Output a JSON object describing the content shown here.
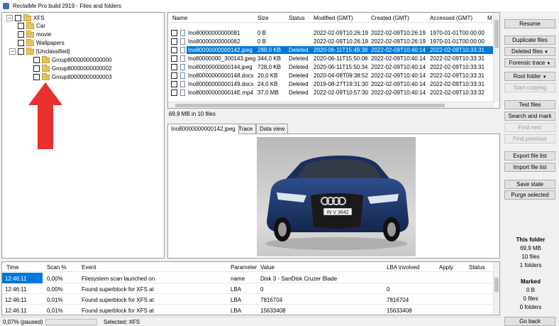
{
  "window": {
    "title": "ReclaiMe Pro build 2919 - Files and folders"
  },
  "tree": {
    "root": {
      "expander": "−",
      "label": "XFS"
    },
    "items": [
      {
        "expander": "",
        "label": "Car"
      },
      {
        "expander": "",
        "label": "movie"
      },
      {
        "expander": "",
        "label": "Wallpapers"
      },
      {
        "expander": "−",
        "label": "[Unclassified]"
      },
      {
        "expander": "",
        "label": "Group80000000000000"
      },
      {
        "expander": "",
        "label": "Group80000000000002"
      },
      {
        "expander": "",
        "label": "Group80000000000003"
      }
    ]
  },
  "filelist": {
    "columns": [
      "Name",
      "Size",
      "Status",
      "Modified (GMT)",
      "Created (GMT)",
      "Accessed (GMT)",
      "M"
    ],
    "rows": [
      {
        "name": "Ino80000000000081",
        "size": "0 B",
        "status": "",
        "modified": "2022-02-09T10:26:19",
        "created": "2022-02-09T10:26:19",
        "accessed": "1970-01-01T00:00:00"
      },
      {
        "name": "Ino80000000000082",
        "size": "0 B",
        "status": "",
        "modified": "2022-02-09T10:26:19",
        "created": "2022-02-09T10:26:19",
        "accessed": "1970-01-01T00:00:00"
      },
      {
        "name": "Ino80000000000142.jpeg",
        "size": "288,0 KB",
        "status": "Deleted",
        "modified": "2020-06-11T15:49:38",
        "created": "2022-02-09T10:40:14",
        "accessed": "2022-02-09T10:33:31"
      },
      {
        "name": "Ino80000000_300143.jpeg",
        "size": "344,0 KB",
        "status": "Deleted",
        "modified": "2020-06-11T15:50:08",
        "created": "2022-02-09T10:40:14",
        "accessed": "2022-02-09T10:33:31"
      },
      {
        "name": "Ino80000000000144.jpeg",
        "size": "728,0 KB",
        "status": "Deleted",
        "modified": "2020-06-11T15:50:34",
        "created": "2022-02-09T10:40:14",
        "accessed": "2022-02-09T10:33:31"
      },
      {
        "name": "Ino80000000000148.docx",
        "size": "20,0 KB",
        "status": "Deleted",
        "modified": "2020-04-08T09:38:52",
        "created": "2022-02-09T10:40:14",
        "accessed": "2022-02-09T10:33:31"
      },
      {
        "name": "Ino80000000000149.docx",
        "size": "24,0 KB",
        "status": "Deleted",
        "modified": "2019-08-27T19:31:30",
        "created": "2022-02-09T10:40:14",
        "accessed": "2022-02-09T10:33:31"
      },
      {
        "name": "Ino8000000000014E.mp4",
        "size": "37,0 MB",
        "status": "Deleted",
        "modified": "2022-02-09T10:57:30",
        "created": "2022-02-09T10:40:14",
        "accessed": "2022-02-09T10:33:32"
      }
    ],
    "summary": "69,9 MB in 10 files"
  },
  "tabs": [
    {
      "label": "Ino80000000000142.jpeg"
    },
    {
      "label": "Trace"
    },
    {
      "label": "Data view"
    }
  ],
  "preview": {
    "plate": "IN V 3642"
  },
  "actions": {
    "resume": "Resume",
    "duplicate": "Duplicate files",
    "deleted": "Deleted files",
    "forensic": "Forensic trace",
    "root_folder": "Root folder",
    "start_copying": "Start copying",
    "test_files": "Test files",
    "search_mark": "Search and mark",
    "find_next": "Find next",
    "find_previous": "Find previous",
    "export_list": "Export file list",
    "import_list": "Import file list",
    "save_state": "Save state",
    "purge": "Purge selected",
    "go_back": "Go back"
  },
  "stats": {
    "this_folder_title": "This folder",
    "this_folder_size": "69,9 MB",
    "this_folder_files": "10 files",
    "this_folder_folders": "1 folders",
    "marked_title": "Marked",
    "marked_size": "0 B",
    "marked_files": "0 files",
    "marked_folders": "0 folders"
  },
  "log": {
    "columns": [
      "Time",
      "Scan %",
      "Event",
      "Parameter",
      "Value",
      "LBA involved",
      "Apply",
      "Status"
    ],
    "rows": [
      {
        "time": "12:46:11",
        "scan": "0,00%",
        "event": "Filesystem scan launched on",
        "param": "name",
        "value": "Disk 3 - SanDisk Cruzer Blade",
        "lba": ""
      },
      {
        "time": "12:46:11",
        "scan": "0,00%",
        "event": "Found superblock for XFS at",
        "param": "LBA",
        "value": "0",
        "lba": "0"
      },
      {
        "time": "12:46:11",
        "scan": "0,01%",
        "event": "Found superblock for XFS at",
        "param": "LBA",
        "value": "7816704",
        "lba": "7816704"
      },
      {
        "time": "12:46:11",
        "scan": "0,01%",
        "event": "Found superblock for XFS at",
        "param": "LBA",
        "value": "15633408",
        "lba": "15633408"
      }
    ]
  },
  "status": {
    "progress_text": "0,07% (paused)",
    "progress_fraction": 0.0007,
    "selected": "Selected: XFS"
  },
  "colors": {
    "selection": "#0078d7",
    "arrow": "#e8302e",
    "folder": "#e7c45b"
  }
}
